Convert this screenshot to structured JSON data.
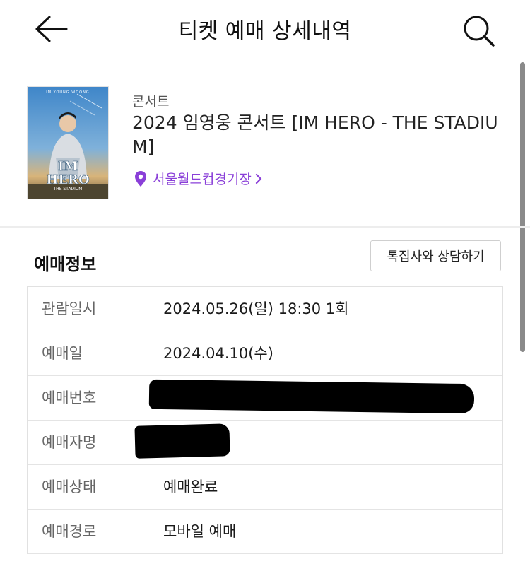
{
  "header": {
    "title": "티켓 예매 상세내역",
    "back_icon": "arrow-left-icon",
    "search_icon": "search-icon"
  },
  "event": {
    "category": "콘서트",
    "title": "2024 임영웅 콘서트 [IM HERO - THE STADIUM]",
    "venue": "서울월드컵경기장",
    "venue_icon": "location-pin-icon",
    "poster": {
      "top_text": "IM YOUNG WOONG",
      "logo_line1": "IM",
      "logo_line2": "HERO",
      "subtitle": "THE STADIUM"
    }
  },
  "booking": {
    "section_title": "예매정보",
    "consult_button": "톡집사와 상담하기",
    "rows": [
      {
        "label": "관람일시",
        "value": "2024.05.26(일) 18:30 1회"
      },
      {
        "label": "예매일",
        "value": "2024.04.10(수)"
      },
      {
        "label": "예매번호",
        "value": ""
      },
      {
        "label": "예매자명",
        "value": ""
      },
      {
        "label": "예매상태",
        "value": "예매완료"
      },
      {
        "label": "예매경로",
        "value": "모바일 예매"
      }
    ]
  },
  "colors": {
    "accent": "#8a3fd8",
    "text": "#1a1a1a",
    "label": "#666666",
    "border": "#e1e1e1"
  }
}
